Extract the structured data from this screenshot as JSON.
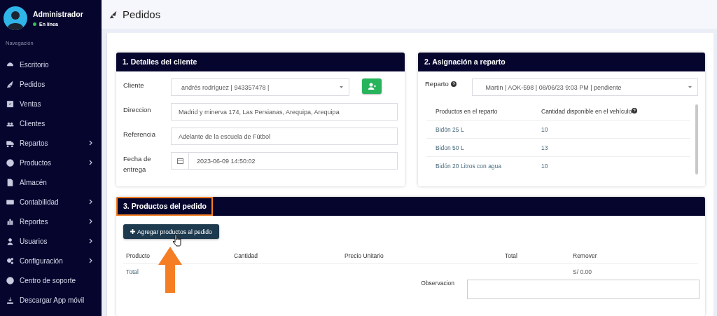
{
  "sidebar": {
    "user": {
      "name": "Administrador",
      "status": "En línea",
      "online": true
    },
    "section": "Navegación",
    "items": [
      {
        "label": "Escritorio",
        "submenu": false
      },
      {
        "label": "Pedidos",
        "submenu": false
      },
      {
        "label": "Ventas",
        "submenu": false
      },
      {
        "label": "Clientes",
        "submenu": false
      },
      {
        "label": "Repartos",
        "submenu": true
      },
      {
        "label": "Productos",
        "submenu": true
      },
      {
        "label": "Almacén",
        "submenu": false
      },
      {
        "label": "Contabilidad",
        "submenu": true
      },
      {
        "label": "Reportes",
        "submenu": true
      },
      {
        "label": "Usuarios",
        "submenu": true
      },
      {
        "label": "Configuración",
        "submenu": true
      },
      {
        "label": "Centro de soporte",
        "submenu": false
      },
      {
        "label": "Descargar App móvil",
        "submenu": false
      }
    ]
  },
  "page": {
    "title": "Pedidos"
  },
  "client_card": {
    "title": "1. Detalles del cliente",
    "fields": [
      {
        "label": "Cliente",
        "kind": "select",
        "value": "andrés rodríguez | 943357478 |"
      },
      {
        "label": "Direccion",
        "kind": "text",
        "value": "Madrid y minerva 174, Las Persianas, Arequipa, Arequipa"
      },
      {
        "label": "Referencia",
        "kind": "text",
        "value": "Adelante de la escuela de Fútbol"
      },
      {
        "label": "Fecha de entrega",
        "kind": "date",
        "value": "2023-06-09 14:50:02"
      }
    ]
  },
  "delivery_card": {
    "title": "2. Asignación a reparto",
    "field": {
      "label": "Reparto",
      "value": "Martin | AOK-598 | 08/06/23 9:03 PM | pendiente"
    },
    "table": {
      "columns": [
        "Productos en el reparto",
        "Cantidad disponible en el vehículo"
      ],
      "rows": [
        [
          "Bidón 25 L",
          "10"
        ],
        [
          "Bidon 50 L",
          "13"
        ],
        [
          "Bidón 20 Litros con agua",
          "10"
        ]
      ]
    }
  },
  "products_card": {
    "title": "3. Productos del pedido",
    "add_button": "Agregar productos al pedido",
    "columns": [
      "Producto",
      "Cantidad",
      "Precio Unitario",
      "Total",
      "Remover"
    ],
    "total_label": "Total",
    "total_value": "S/ 0.00",
    "observation_label": "Observacion"
  }
}
